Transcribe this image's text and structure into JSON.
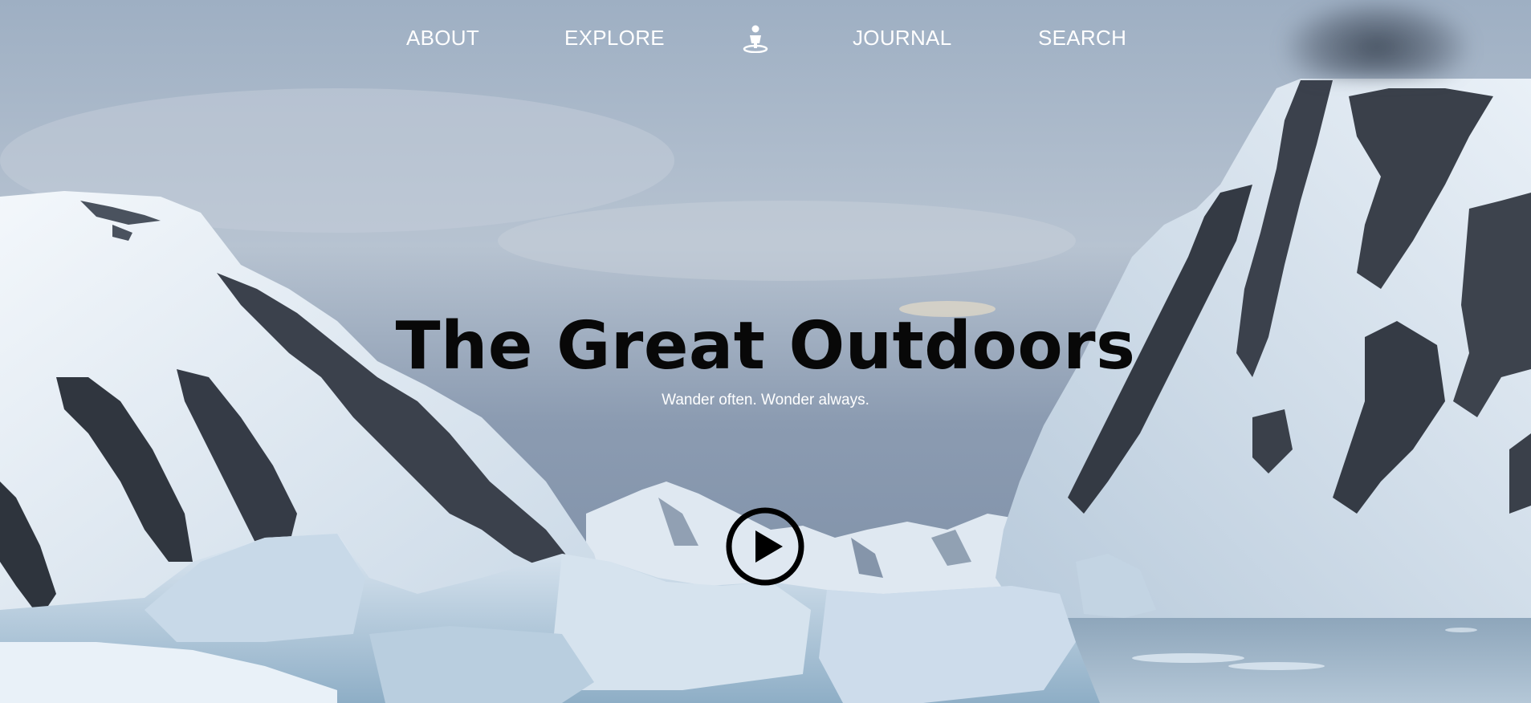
{
  "nav": {
    "items": [
      {
        "label": "ABOUT"
      },
      {
        "label": "EXPLORE"
      },
      {
        "label": "JOURNAL"
      },
      {
        "label": "SEARCH"
      }
    ],
    "logo_icon": "hiker-icon"
  },
  "hero": {
    "title": "The Great Outdoors",
    "subtitle": "Wander often. Wonder always.",
    "play_icon": "play-circle-icon"
  },
  "colors": {
    "nav_text": "#ffffff",
    "title_text": "#080808",
    "subtitle_text": "#ffffff",
    "play_button": "#000000",
    "sky": "#aebccd",
    "snow": "#e8eff6",
    "rock": "#3b414c",
    "ice_water": "#8fb0c8"
  }
}
